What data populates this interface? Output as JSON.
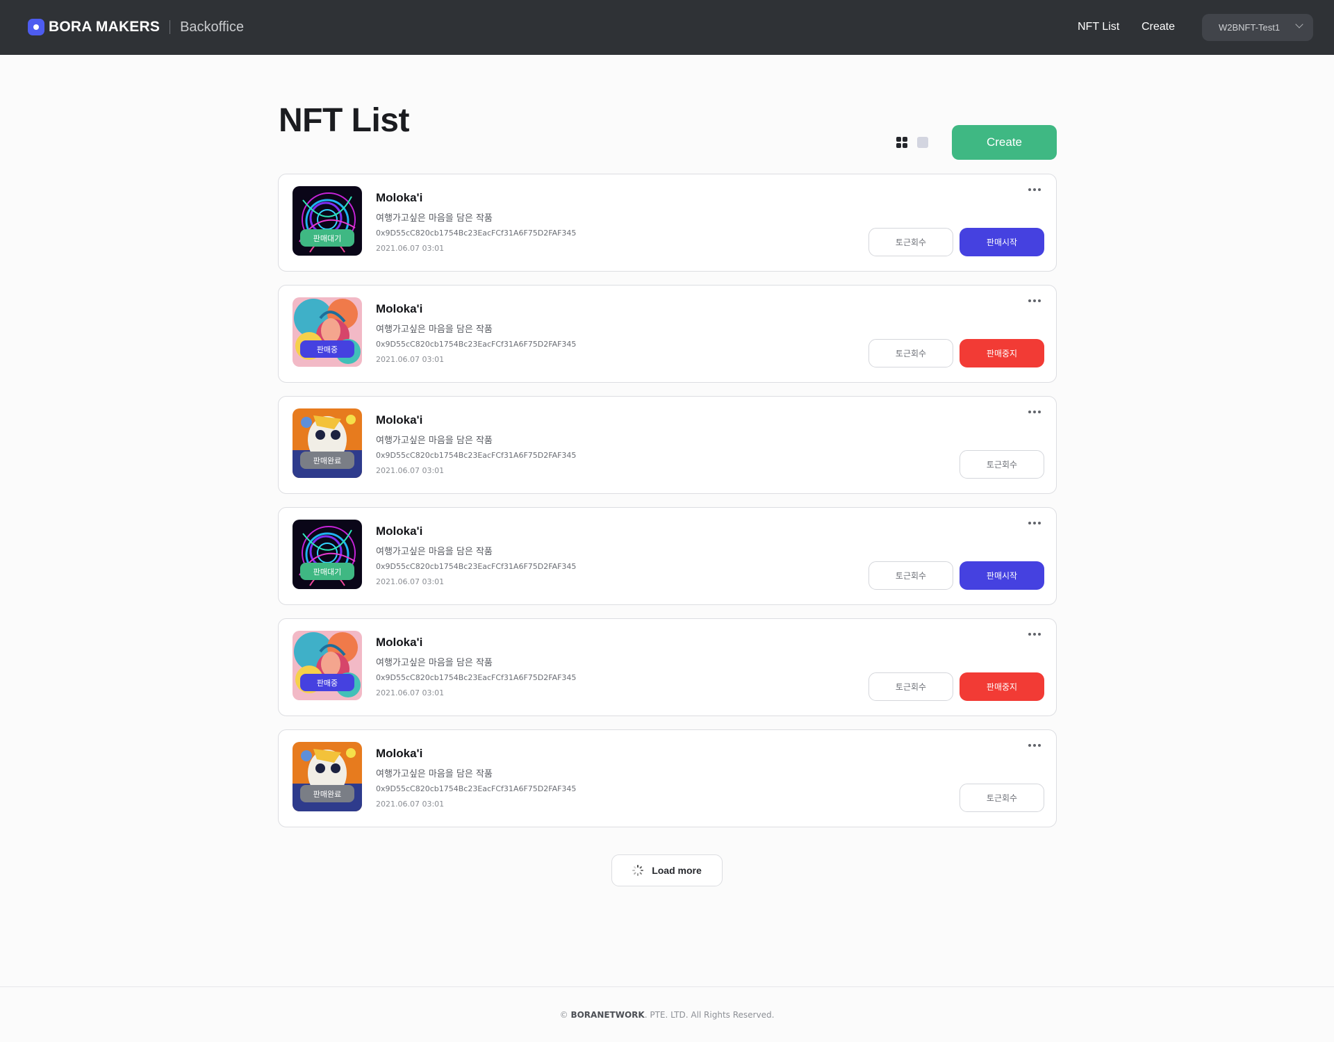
{
  "header": {
    "brand": "BORA MAKERS",
    "section": "Backoffice",
    "nav": [
      "NFT List",
      "Create"
    ],
    "account": "W2BNFT-Test1"
  },
  "page": {
    "title": "NFT List",
    "create_label": "Create"
  },
  "items": [
    {
      "name": "Moloka'i",
      "description": "여행가고싶은 마음을 담은 작품",
      "address": "0x9D55cC820cb1754Bc23EacFCf31A6F75D2FAF345",
      "date": "2021.06.07 03:01",
      "status": "판매대기",
      "image": "swirl-art",
      "buttons": [
        "토근회수",
        "판매시작"
      ]
    },
    {
      "name": "Moloka'i",
      "description": "여행가고싶은 마음을 담은 작품",
      "address": "0x9D55cC820cb1754Bc23EacFCf31A6F75D2FAF345",
      "date": "2021.06.07 03:01",
      "status": "판매중",
      "image": "portrait-art",
      "buttons": [
        "토근회수",
        "판매중지"
      ]
    },
    {
      "name": "Moloka'i",
      "description": "여행가고싶은 마음을 담은 작품",
      "address": "0x9D55cC820cb1754Bc23EacFCf31A6F75D2FAF345",
      "date": "2021.06.07 03:01",
      "status": "판매완료",
      "image": "face-art",
      "buttons": [
        "토근회수"
      ]
    },
    {
      "name": "Moloka'i",
      "description": "여행가고싶은 마음을 담은 작품",
      "address": "0x9D55cC820cb1754Bc23EacFCf31A6F75D2FAF345",
      "date": "2021.06.07 03:01",
      "status": "판매대기",
      "image": "swirl-art",
      "buttons": [
        "토근회수",
        "판매시작"
      ]
    },
    {
      "name": "Moloka'i",
      "description": "여행가고싶은 마음을 담은 작품",
      "address": "0x9D55cC820cb1754Bc23EacFCf31A6F75D2FAF345",
      "date": "2021.06.07 03:01",
      "status": "판매중",
      "image": "portrait-art",
      "buttons": [
        "토근회수",
        "판매중지"
      ]
    },
    {
      "name": "Moloka'i",
      "description": "여행가고싶은 마음을 담은 작품",
      "address": "0x9D55cC820cb1754Bc23EacFCf31A6F75D2FAF345",
      "date": "2021.06.07 03:01",
      "status": "판매완료",
      "image": "face-art",
      "buttons": [
        "토근회수"
      ]
    }
  ],
  "load_more": "Load more",
  "footer": {
    "prefix": "©",
    "company": "BORANETWORK",
    "suffix": ". PTE. LTD. All Rights Reserved."
  },
  "colors": {
    "header_bg": "#2f3236",
    "brand_blue": "#4d5cf0",
    "create_green": "#3fb883",
    "start_blue": "#4541e0",
    "stop_red": "#f23b35",
    "done_gray": "#7a7e86"
  }
}
